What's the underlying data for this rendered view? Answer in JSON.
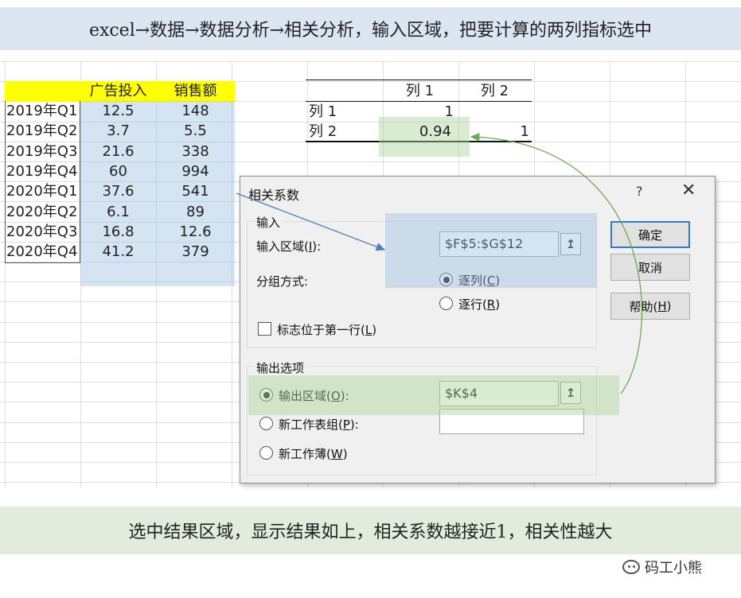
{
  "banner_top": "excel→数据→数据分析→相关分析，输入区域，把要计算的两列指标选中",
  "banner_bottom": "选中结果区域，显示结果如上，相关系数越接近1，相关性越大",
  "source_table": {
    "headers": [
      "广告投入",
      "销售额"
    ],
    "rows": [
      {
        "label": "2019年Q1",
        "ad": "12.5",
        "sales": "148"
      },
      {
        "label": "2019年Q2",
        "ad": "3.7",
        "sales": "5.5"
      },
      {
        "label": "2019年Q3",
        "ad": "21.6",
        "sales": "338"
      },
      {
        "label": "2019年Q4",
        "ad": "60",
        "sales": "994"
      },
      {
        "label": "2020年Q1",
        "ad": "37.6",
        "sales": "541"
      },
      {
        "label": "2020年Q2",
        "ad": "6.1",
        "sales": "89"
      },
      {
        "label": "2020年Q3",
        "ad": "16.8",
        "sales": "12.6"
      },
      {
        "label": "2020年Q4",
        "ad": "41.2",
        "sales": "379"
      }
    ]
  },
  "result_table": {
    "col_headers": [
      "列 1",
      "列 2"
    ],
    "row_labels": [
      "列 1",
      "列 2"
    ],
    "r1c1": "1",
    "r2c1": "0.94",
    "r2c2": "1"
  },
  "dialog": {
    "title": "相关系数",
    "help_q": "?",
    "close": "✕",
    "input_group": "输入",
    "input_range_label": "输入区域(",
    "input_range_key": "I",
    "input_range_suffix": "):",
    "input_range_value": "$F$5:$G$12",
    "grouping_label": "分组方式:",
    "by_col_label": "逐列(",
    "by_col_key": "C",
    "by_row_label": "逐行(",
    "by_row_key": "R",
    "labels_first_row": "标志位于第一行(",
    "labels_key": "L",
    "output_group": "输出选项",
    "output_range_label": "输出区域(",
    "output_range_key": "O",
    "output_range_suffix": "):",
    "output_range_value": "$K$4",
    "new_sheet_label": "新工作表组(",
    "new_sheet_key": "P",
    "new_sheet_suffix": "):",
    "new_book_label": "新工作薄(",
    "new_book_key": "W",
    "ok": "确定",
    "cancel": "取消",
    "help_label": "帮助(",
    "help_key": "H",
    "pick_icon": "↥"
  },
  "watermark": "码工小熊",
  "colors": {
    "header_yellow": "#ffff00",
    "highlight_blue": "#9bbee1",
    "highlight_green": "#aad296",
    "arrow_blue": "#4a7fc0",
    "arrow_green": "#6aab4f"
  }
}
